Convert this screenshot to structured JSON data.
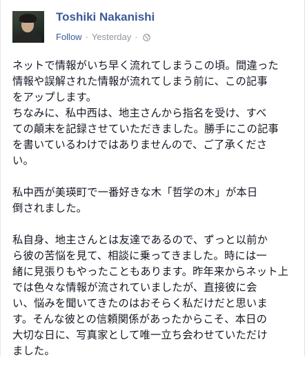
{
  "author": {
    "name": "Toshiki Nakanishi"
  },
  "meta": {
    "follow_label": "Follow",
    "separator": "·",
    "timestamp": "Yesterday",
    "audience_icon": "globe-icon"
  },
  "post": {
    "paragraphs": [
      {
        "lines": [
          "ネットで情報がいち早く流れてしまうこの頃。間違った",
          "情報や誤解された情報が流れてしまう前に、この記事",
          "をアップします。",
          "ちなみに、私中西は、地主さんから指名を受け、すべ",
          "ての顛末を記録させていただきました。勝手にこの記事",
          "を書いているわけではありませんので、ご了承くださ",
          "い。"
        ]
      },
      {
        "lines": [
          "私中西が美瑛町で一番好きな木「哲学の木」が本日",
          "倒されました。"
        ]
      },
      {
        "lines": [
          "私自身、地主さんとは友達であるので、ずっと以前か",
          "ら彼の苦悩を見て、相談に乗ってきました。時には一",
          "緒に見張りもやったこともあります。昨年来からネット上",
          "では色々な情報が流されていましたが、直接彼に会",
          "い、悩みを聞いてきたのはおそらく私だけだと思いま",
          "す。そんな彼との信頼関係があったからこそ、本日の",
          "大切な日に、写真家として唯一立ち会わせていただけ",
          "ました。"
        ]
      }
    ]
  },
  "colors": {
    "name": "#3b5998",
    "follow": "#365899",
    "meta": "#90949c",
    "text": "#141823"
  }
}
